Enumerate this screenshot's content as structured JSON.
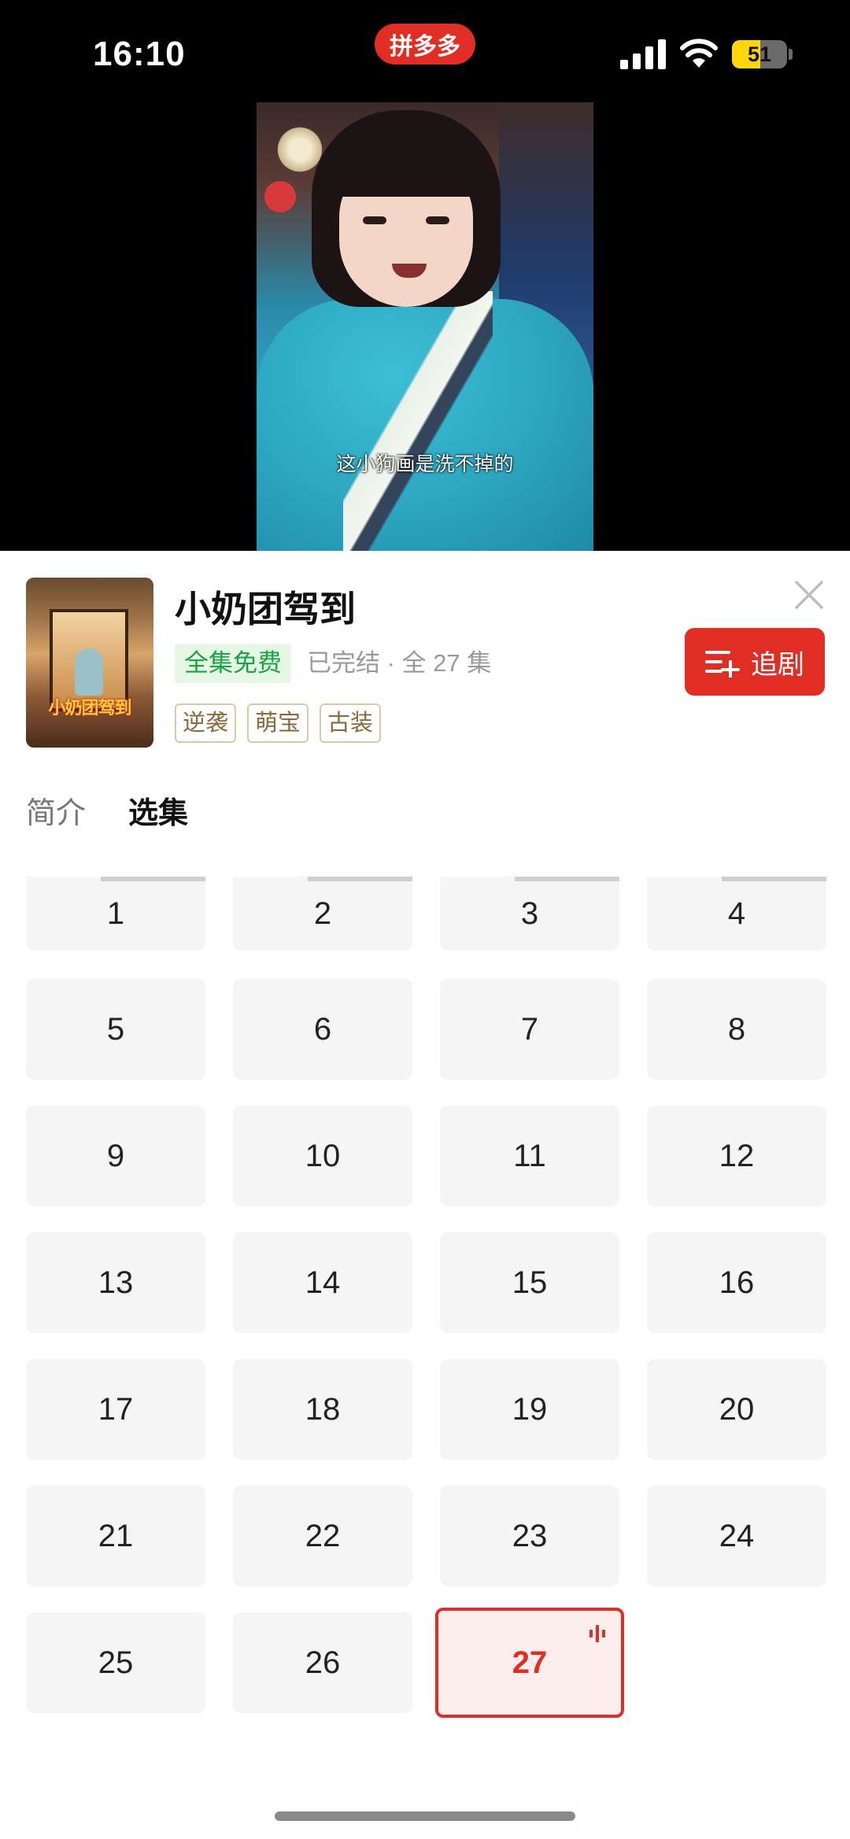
{
  "status_bar": {
    "time": "16:10",
    "app_name": "拼多多",
    "battery_level": "51"
  },
  "video": {
    "subtitle": "这小狗画是洗不掉的"
  },
  "drama": {
    "title": "小奶团驾到",
    "poster_title": "小奶团驾到",
    "free_badge": "全集免费",
    "episode_info": "已完结 · 全 27 集",
    "tags": [
      "逆袭",
      "萌宝",
      "古装"
    ],
    "follow_label": "追剧"
  },
  "tabs": [
    {
      "label": "简介",
      "active": false
    },
    {
      "label": "选集",
      "active": true
    }
  ],
  "episodes": {
    "items": [
      "1",
      "2",
      "3",
      "4",
      "5",
      "6",
      "7",
      "8",
      "9",
      "10",
      "11",
      "12",
      "13",
      "14",
      "15",
      "16",
      "17",
      "18",
      "19",
      "20",
      "21",
      "22",
      "23",
      "24",
      "25",
      "26",
      "27"
    ],
    "current": "27"
  },
  "colors": {
    "brand_red": "#e02e24",
    "free_green": "#1aa343",
    "tag_brown": "#8a6a3a"
  },
  "icons": {
    "close": "close-icon",
    "follow": "playlist-add-icon",
    "playing": "equalizer-icon",
    "signal": "cellular-signal-icon",
    "wifi": "wifi-icon"
  }
}
